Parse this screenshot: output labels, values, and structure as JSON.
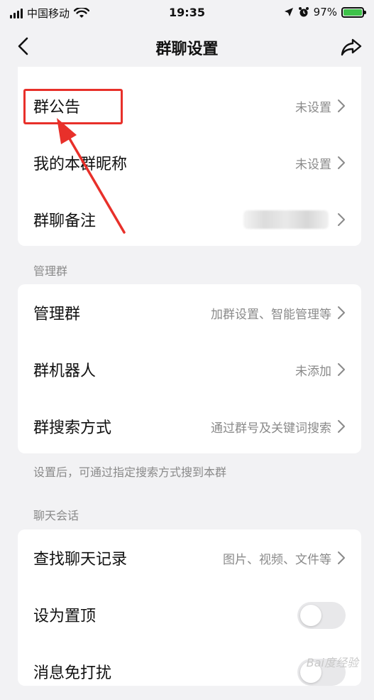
{
  "status_bar": {
    "carrier": "中国移动",
    "time": "19:35",
    "battery": "97%"
  },
  "nav": {
    "title": "群聊设置"
  },
  "group_basic": {
    "announcement": {
      "label": "群公告",
      "value": "未设置"
    },
    "my_nickname": {
      "label": "我的本群昵称",
      "value": "未设置"
    },
    "remark": {
      "label": "群聊备注",
      "value": ""
    }
  },
  "manage": {
    "section_title": "管理群",
    "manage_group": {
      "label": "管理群",
      "value": "加群设置、智能管理等"
    },
    "robot": {
      "label": "群机器人",
      "value": "未添加"
    },
    "search_method": {
      "label": "群搜索方式",
      "value": "通过群号及关键词搜索"
    },
    "hint": "设置后，可通过指定搜索方式搜到本群"
  },
  "chat": {
    "section_title": "聊天会话",
    "find_history": {
      "label": "查找聊天记录",
      "value": "图片、视频、文件等"
    },
    "pin_top": {
      "label": "设为置顶"
    },
    "mute": {
      "label": "消息免打扰"
    }
  },
  "watermark": "Bai度经验",
  "colors": {
    "highlight": "#e8302a",
    "battery": "#3ec24a"
  }
}
